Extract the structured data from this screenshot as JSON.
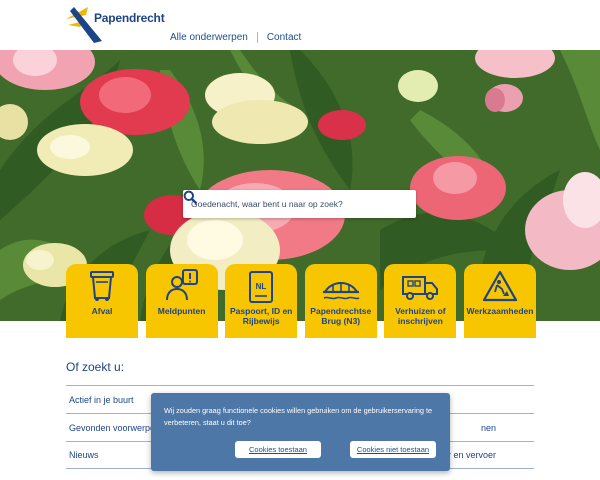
{
  "header": {
    "logo_text": "Papendrecht",
    "nav": [
      {
        "label": "Alle onderwerpen"
      },
      {
        "label": "Contact"
      }
    ]
  },
  "search": {
    "placeholder": "Goedenacht, waar bent u naar op zoek?",
    "icon": "search-icon"
  },
  "tiles": [
    {
      "label": "Afval",
      "icon": "trash-bin-icon"
    },
    {
      "label": "Meldpunten",
      "icon": "person-alert-icon"
    },
    {
      "label": "Paspoort, ID en Rijbewijs",
      "icon": "passport-icon",
      "icon_text": "NL"
    },
    {
      "label": "Papendrechtse Brug (N3)",
      "icon": "bridge-icon"
    },
    {
      "label": "Verhuizen of inschrijven",
      "icon": "moving-truck-icon"
    },
    {
      "label": "Werkzaamheden",
      "icon": "roadwork-sign-icon"
    }
  ],
  "lower": {
    "title": "Of zoekt u:",
    "rows": [
      {
        "left": "Actief in je buurt",
        "right": ""
      },
      {
        "left": "Gevonden voorwerpen",
        "right": "nen"
      },
      {
        "left": "Nieuws",
        "right": "r en vervoer"
      }
    ]
  },
  "cookie": {
    "text": "Wij zouden graag functionele cookies willen gebruiken om de gebruikerservaring te verbeteren, staat u dit toe?",
    "accept_label": "Cookies toestaan",
    "decline_label": "Cookies niet toestaan"
  },
  "colors": {
    "brand_blue": "#1d4486",
    "tile_yellow": "#f7c600",
    "cookie_blue": "#4d77a6"
  }
}
